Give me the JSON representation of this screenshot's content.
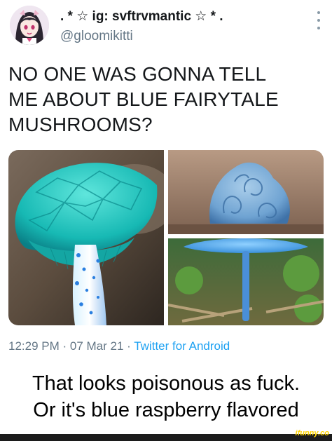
{
  "tweet": {
    "display_name": ". * ☆ ig: svftrvmantic ☆ * .",
    "handle": "@gloomikitti",
    "text": "NO ONE WAS GONNA TELL\nME ABOUT BLUE FAIRYTALE\nMUSHROOMS?",
    "time": "12:29 PM",
    "date": "07 Mar 21",
    "client": "Twitter for Android",
    "separator": " · "
  },
  "reply_caption": "That looks poisonous as fuck.\nOr it's blue raspberry flavored",
  "watermark": "ifunny.co",
  "icons": {
    "avatar": "anime-avatar-icon",
    "more": "more-vertical-icon"
  },
  "colors": {
    "link_blue": "#1da1f2",
    "meta_gray": "#657786",
    "mushroom_teal": "#1fc7c4",
    "mushroom_blue": "#6fa9d6"
  }
}
